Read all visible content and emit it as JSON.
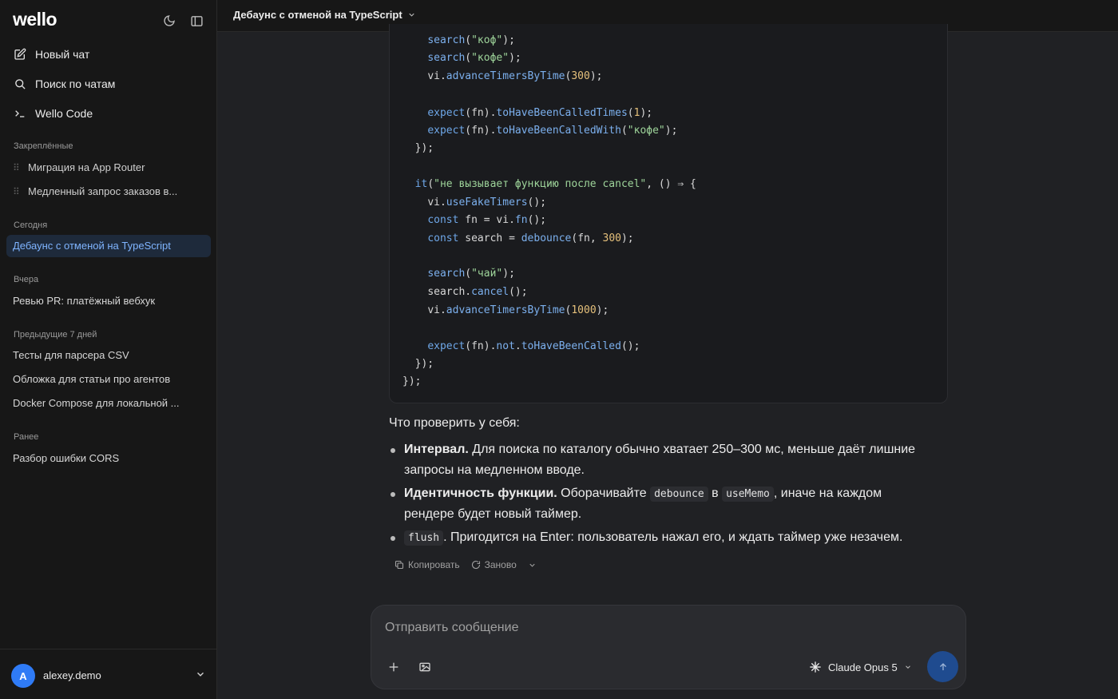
{
  "app": {
    "logo": "wello"
  },
  "sidebar": {
    "nav": [
      {
        "label": "Новый чат",
        "icon": "edit-icon"
      },
      {
        "label": "Поиск по чатам",
        "icon": "search-icon"
      },
      {
        "label": "Wello Code",
        "icon": "terminal-icon"
      }
    ],
    "pinned_label": "Закреплённые",
    "pinned": [
      "Миграция на App Router",
      "Медленный запрос заказов в..."
    ],
    "today_label": "Сегодня",
    "today": [
      "Дебаунс с отменой на TypeScript"
    ],
    "yesterday_label": "Вчера",
    "yesterday": [
      "Ревью PR: платёжный вебхук"
    ],
    "week_label": "Предыдущие 7 дней",
    "week": [
      "Тесты для парсера CSV",
      "Обложка для статьи про агентов",
      "Docker Compose для локальной ..."
    ],
    "earlier_label": "Ранее",
    "earlier": [
      "Разбор ошибки CORS"
    ],
    "user": {
      "initial": "A",
      "name": "alexey.demo"
    }
  },
  "topbar": {
    "title": "Дебаунс с отменой на TypeScript"
  },
  "message": {
    "lead": "Что проверить у себя:",
    "bullets": [
      {
        "bold": "Интервал.",
        "text1": " Для поиска по каталогу обычно хватает 250–300 мс, меньше даёт лишние",
        "text2": "запросы на медленном вводе."
      },
      {
        "bold": "Идентичность функции.",
        "text1": " Оборачивайте ",
        "code1": "debounce",
        "mid": " в ",
        "code2": "useMemo",
        "text2": ", иначе на каждом",
        "text3": "рендере будет новый таймер."
      },
      {
        "code": "flush",
        "text": ". Пригодится на Enter: пользователь нажал его, и ждать таймер уже незачем."
      }
    ],
    "actions": {
      "copy": "Копировать",
      "retry": "Заново"
    }
  },
  "composer": {
    "placeholder": "Отправить сообщение",
    "model": "Claude Opus 5"
  },
  "colors": {
    "accent": "#2f7bf6",
    "active_bg": "#1e2a3b",
    "active_text": "#7fb4ff"
  },
  "code": {
    "lines": [
      "    search(\"коф\");",
      "    search(\"кофе\");",
      "    vi.advanceTimersByTime(300);",
      "",
      "    expect(fn).toHaveBeenCalledTimes(1);",
      "    expect(fn).toHaveBeenCalledWith(\"кофе\");",
      "  });",
      "",
      "  it(\"не вызывает функцию после cancel\", () ⇒ {",
      "    vi.useFakeTimers();",
      "    const fn = vi.fn();",
      "    const search = debounce(fn, 300);",
      "",
      "    search(\"чай\");",
      "    search.cancel();",
      "    vi.advanceTimersByTime(1000);",
      "",
      "    expect(fn).not.toHaveBeenCalled();",
      "  });",
      "});"
    ]
  }
}
